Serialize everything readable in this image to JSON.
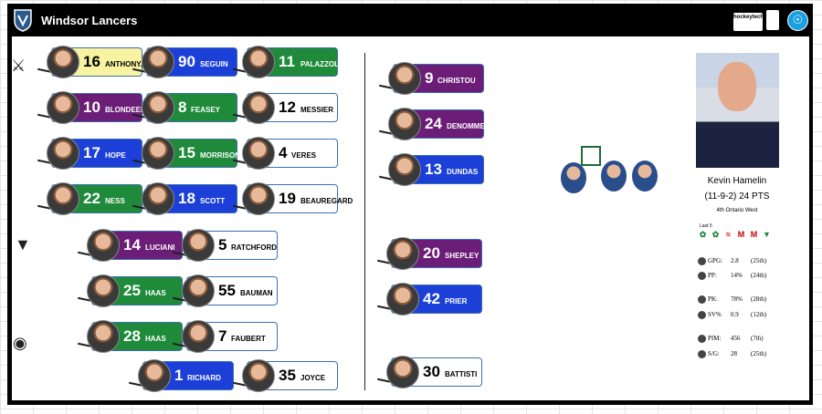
{
  "app": {
    "title": "Windsor Lancers",
    "brand_color": "#000000"
  },
  "header": {
    "hockeytech": "hockeytech"
  },
  "forwards": [
    {
      "number": "16",
      "name": "ANTHONY.",
      "color": "yellow"
    },
    {
      "number": "90",
      "name": "SEGUIN",
      "color": "blue"
    },
    {
      "number": "11",
      "name": "PALAZZOLO",
      "color": "green"
    },
    {
      "number": "10",
      "name": "BLONDEEL",
      "color": "purple"
    },
    {
      "number": "8",
      "name": "FEASEY",
      "color": "green"
    },
    {
      "number": "12",
      "name": "MESSIER",
      "color": "white"
    },
    {
      "number": "17",
      "name": "HOPE",
      "color": "blue"
    },
    {
      "number": "15",
      "name": "MORRISON",
      "color": "green"
    },
    {
      "number": "4",
      "name": "VERES",
      "color": "white"
    },
    {
      "number": "22",
      "name": "NESS",
      "color": "green"
    },
    {
      "number": "18",
      "name": "SCOTT",
      "color": "blue"
    },
    {
      "number": "19",
      "name": "BEAUREGARD",
      "color": "white"
    }
  ],
  "defense": [
    {
      "number": "14",
      "name": "LUCIANI",
      "color": "purple"
    },
    {
      "number": "5",
      "name": "RATCHFORD",
      "color": "white"
    },
    {
      "number": "25",
      "name": "HAAS",
      "color": "green"
    },
    {
      "number": "55",
      "name": "BAUMAN",
      "color": "white"
    },
    {
      "number": "28",
      "name": "HAAS",
      "color": "green"
    },
    {
      "number": "7",
      "name": "FAUBERT",
      "color": "white"
    }
  ],
  "goalies": [
    {
      "number": "1",
      "name": "RICHARD",
      "color": "blue"
    },
    {
      "number": "35",
      "name": "JOYCE",
      "color": "white"
    }
  ],
  "extras": [
    {
      "number": "9",
      "name": "CHRISTOU",
      "color": "purple"
    },
    {
      "number": "24",
      "name": "DENOMME",
      "color": "purple"
    },
    {
      "number": "13",
      "name": "DUNDAS",
      "color": "blue"
    },
    {
      "number": "20",
      "name": "SHEPLEY",
      "color": "purple"
    },
    {
      "number": "42",
      "name": "PRIER",
      "color": "blue"
    },
    {
      "number": "30",
      "name": "BATTISTI",
      "color": "white"
    }
  ],
  "coach": {
    "name": "Kevin Hamelin",
    "record": "(11-9-2) 24 PTS",
    "division": "4th Ontario West",
    "last5_label": "Last 5",
    "stats": [
      {
        "label": "GPG:",
        "value": "2.8",
        "rank": "(25th)"
      },
      {
        "label": "PP:",
        "value": "14%",
        "rank": "(24th)"
      },
      {
        "label": "PK:",
        "value": "78%",
        "rank": "(28th)"
      },
      {
        "label": "SV%",
        "value": "0.9",
        "rank": "(12th)"
      },
      {
        "label": "PIM:",
        "value": "456",
        "rank": "(7th)"
      },
      {
        "label": "S/G:",
        "value": "28",
        "rank": "(25th)"
      }
    ]
  },
  "colors": {
    "yellow": "#f7f3a0",
    "blue": "#1c3fd8",
    "green": "#1e8a3a",
    "purple": "#6b1d78",
    "white": "#ffffff"
  }
}
